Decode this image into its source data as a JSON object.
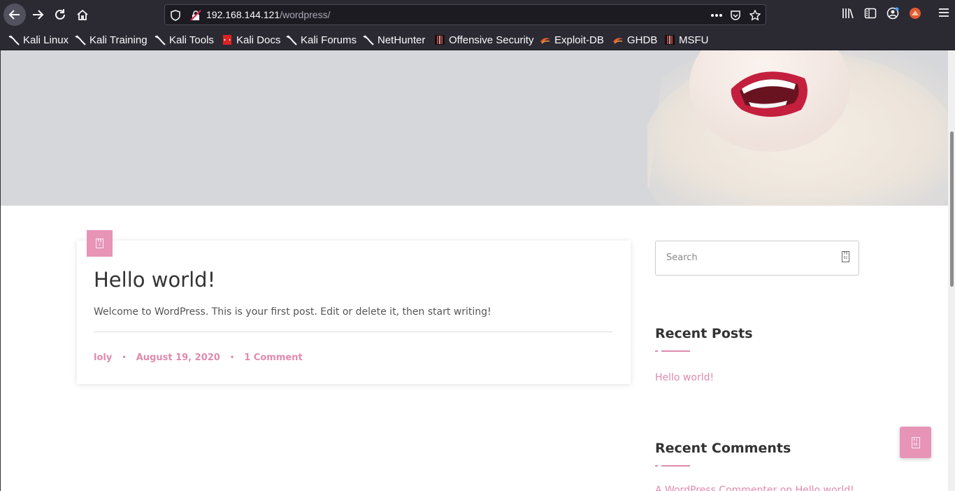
{
  "browser": {
    "url_host": "192.168.144.121",
    "url_path": "/wordpress/",
    "bookmarks": [
      {
        "label": "Kali Linux",
        "icon": "kali-dragon-icon"
      },
      {
        "label": "Kali Training",
        "icon": "kali-dragon-icon"
      },
      {
        "label": "Kali Tools",
        "icon": "kali-dragon-icon"
      },
      {
        "label": "Kali Docs",
        "icon": "kali-docs-icon"
      },
      {
        "label": "Kali Forums",
        "icon": "kali-dragon-icon"
      },
      {
        "label": "NetHunter",
        "icon": "kali-dragon-icon"
      },
      {
        "label": "Offensive Security",
        "icon": "offsec-icon"
      },
      {
        "label": "Exploit-DB",
        "icon": "exploitdb-icon"
      },
      {
        "label": "GHDB",
        "icon": "exploitdb-icon"
      },
      {
        "label": "MSFU",
        "icon": "offsec-icon"
      }
    ]
  },
  "post": {
    "title": "Hello world!",
    "excerpt": "Welcome to WordPress. This is your first post. Edit or delete it, then start writing!",
    "author": "loly",
    "date": "August 19, 2020",
    "comments": "1 Comment",
    "separator": "•"
  },
  "sidebar": {
    "search_placeholder": "Search",
    "recent_posts_title": "Recent Posts",
    "recent_posts": [
      "Hello world!"
    ],
    "recent_comments_title": "Recent Comments",
    "recent_comment_text": "A WordPress Commenter on Hello world!"
  },
  "colors": {
    "accent": "#e08aae",
    "button_bg": "#e794b7",
    "toolbar_bg": "#2b2a33"
  }
}
